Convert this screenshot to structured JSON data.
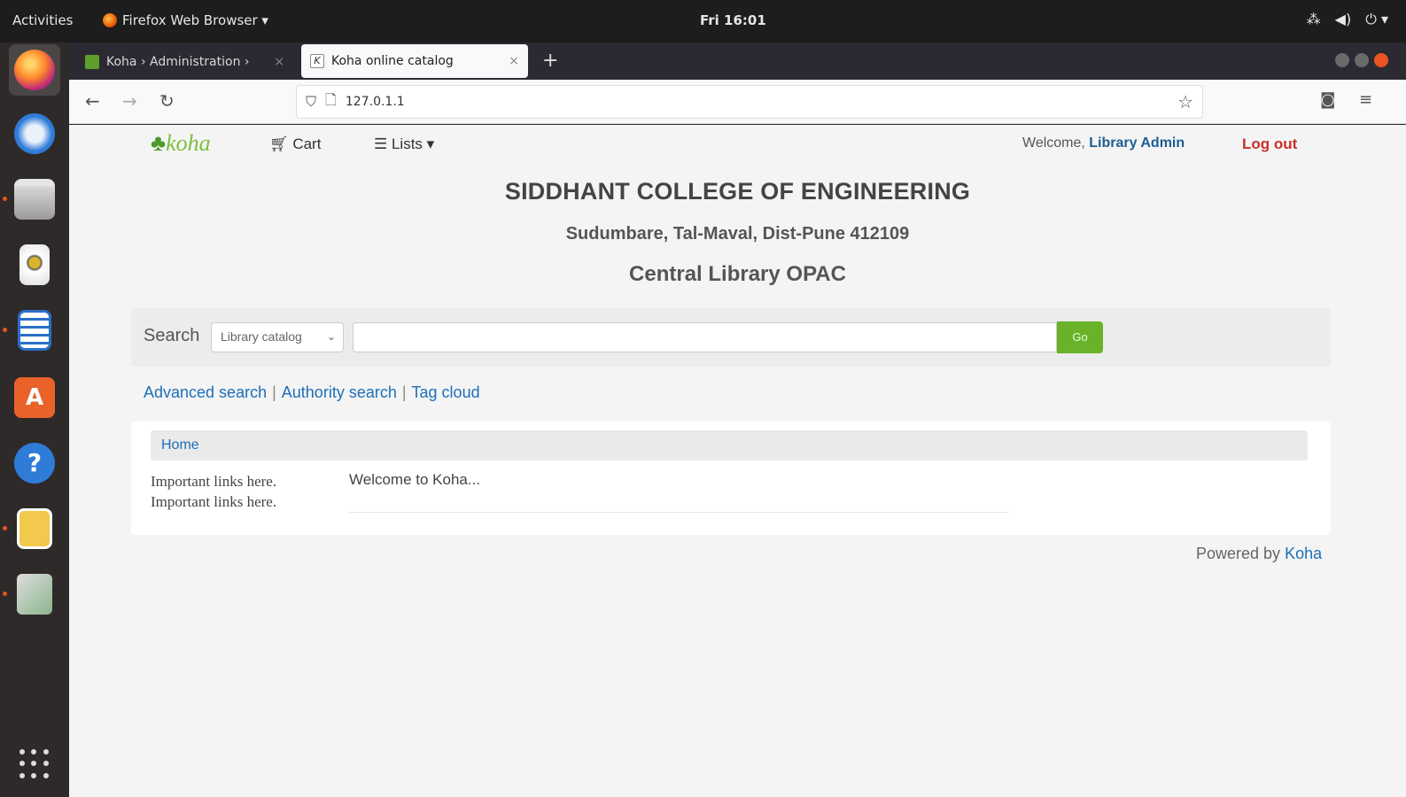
{
  "system": {
    "activities": "Activities",
    "app_menu": "Firefox Web Browser ▾",
    "clock": "Fri 16:01",
    "tray_network": "⁂",
    "tray_volume": "◀)",
    "tray_power": "⏻ ▾"
  },
  "browser": {
    "tabs": [
      {
        "title": "Koha › Administration ›",
        "close": "×"
      },
      {
        "title": "Koha online catalog",
        "close": "×"
      }
    ],
    "new_tab": "+",
    "back": "←",
    "forward": "→",
    "reload": "↻",
    "url": "127.0.1.1",
    "bookmark_star": "☆",
    "pocket": "◙",
    "menu": "≡"
  },
  "koha": {
    "logo": "koha",
    "cart": "Cart",
    "lists": "Lists ▾",
    "welcome_prefix": "Welcome, ",
    "user": "Library Admin",
    "logout": "Log out",
    "college": "SIDDHANT COLLEGE OF ENGINEERING",
    "address": "Sudumbare, Tal-Maval, Dist-Pune 412109",
    "subtitle": "Central Library OPAC",
    "search_label": "Search",
    "search_scope": "Library catalog",
    "search_placeholder": "",
    "go_button": "Go",
    "links": [
      "Advanced search",
      "Authority search",
      "Tag cloud"
    ],
    "breadcrumb": "Home",
    "important_1": "Important links here.",
    "important_2": "Important links here.",
    "welcome_message": "Welcome to Koha...",
    "powered_prefix": "Powered by ",
    "powered_link": "Koha"
  },
  "colors": {
    "accent_green": "#69b229",
    "link_blue": "#1d6fb8",
    "logout_red": "#c9302c",
    "ubuntu_orange": "#e95420"
  }
}
